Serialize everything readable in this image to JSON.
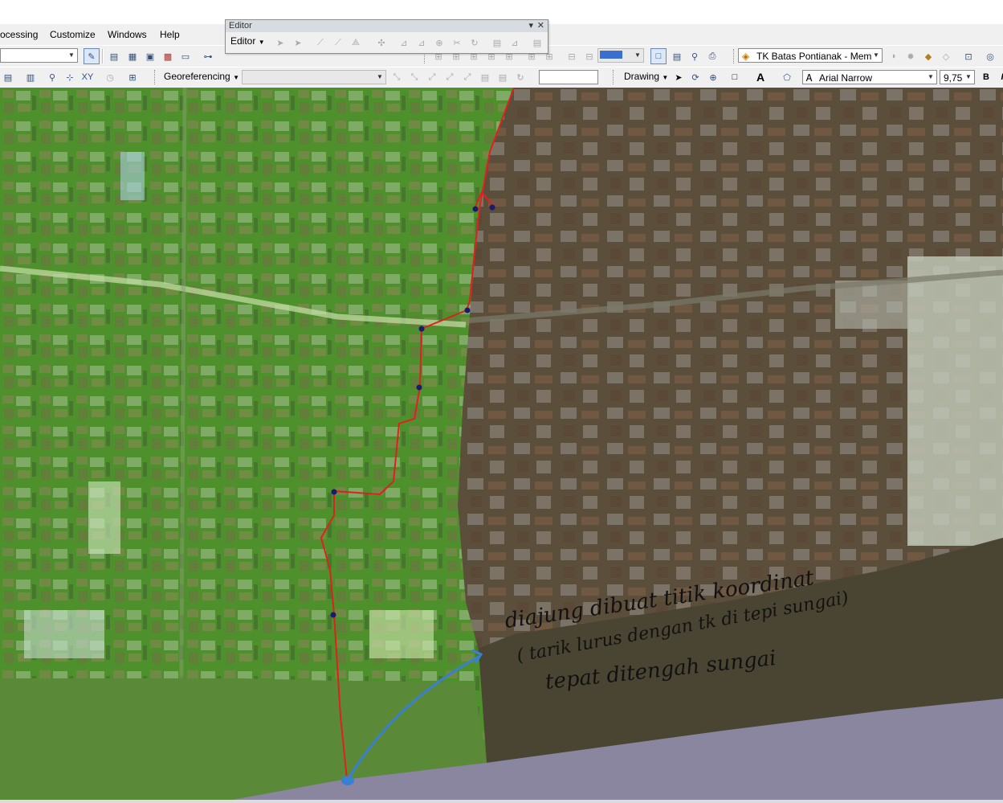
{
  "menubar": {
    "items": [
      "ocessing",
      "Customize",
      "Windows",
      "Help"
    ]
  },
  "editor_toolbar": {
    "window_title": "Editor",
    "dropdown_label": "Editor"
  },
  "standard_toolbar": {
    "layer_combo_value": "TK Batas Pontianak - Mem"
  },
  "georef_toolbar": {
    "label": "Georeferencing",
    "layer_combo_value": ""
  },
  "drawing_toolbar": {
    "label": "Drawing",
    "font_name": "Arial Narrow",
    "font_size": "9,75",
    "bold_label": "B",
    "italic_label": "I",
    "text_tool_label": "A"
  },
  "map": {
    "annotation_lines": [
      "diajung dibuat titik koordinat",
      "( tarik lurus dengan tk di tepi sungai)",
      "tepat ditengah sungai"
    ],
    "colors": {
      "left_overlay": "#4e8a2a",
      "right_overlay": "#3b3a22",
      "river_bottom": "#8a86a0",
      "boundary_line": "#e02020",
      "vertex": "#1a1a6e",
      "arrow": "#3a7fd0"
    }
  }
}
